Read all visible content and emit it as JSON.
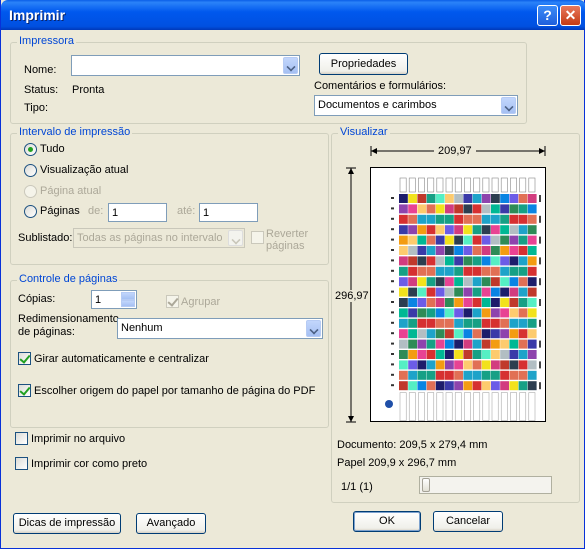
{
  "window": {
    "title": "Imprimir",
    "help_glyph": "?",
    "close_glyph": "✕"
  },
  "printer": {
    "group_title": "Impressora",
    "name_label": "Nome:",
    "name_value": "",
    "status_label": "Status:",
    "status_value": "Pronta",
    "type_label": "Tipo:",
    "type_value": "",
    "properties_button": "Propriedades",
    "comments_label": "Comentários e formulários:",
    "comments_value": "Documentos e carimbos"
  },
  "range": {
    "group_title": "Intervalo de impressão",
    "all": "Tudo",
    "current_view": "Visualização atual",
    "current_page": "Página atual",
    "pages": "Páginas",
    "from_label": "de:",
    "from_value": "1",
    "to_label": "até:",
    "to_value": "1",
    "subset_label": "Sublistado:",
    "subset_value": "Todas as páginas no intervalo",
    "reverse_label": "Reverter páginas",
    "selected": "all"
  },
  "page_handling": {
    "group_title": "Controle de páginas",
    "copies_label": "Cópias:",
    "copies_value": "1",
    "collate_label": "Agrupar",
    "scaling_label": "Redimensionamento de páginas:",
    "scaling_value": "Nenhum",
    "auto_rotate_label": "Girar automaticamente e centralizar",
    "choose_source_label": "Escolher origem do papel por tamanho de página do PDF"
  },
  "options": {
    "print_to_file": "Imprimir no arquivo",
    "print_color_as_black": "Imprimir cor como preto"
  },
  "preview": {
    "group_title": "Visualizar",
    "width": "209,97",
    "height": "296,97",
    "document_info": "Documento: 209,5 x 279,4 mm",
    "paper_info": "Papel 209,9 x 296,7 mm",
    "page_indicator": "1/1 (1)"
  },
  "buttons": {
    "tips": "Dicas de impressão",
    "advanced": "Avançado",
    "ok": "OK",
    "cancel": "Cancelar"
  },
  "colors": {
    "title_bar": "#0058ee",
    "dialog_bg": "#ece9d8",
    "group_title": "#0046d5",
    "check_green": "#21a121"
  }
}
